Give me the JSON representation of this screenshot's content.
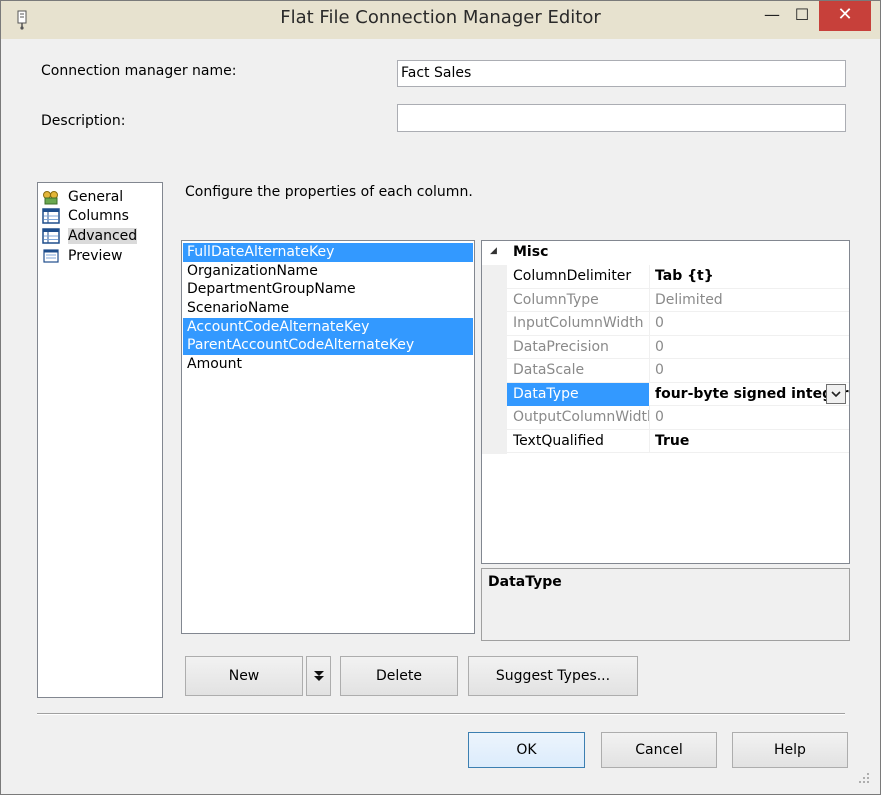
{
  "window": {
    "title": "Flat File Connection Manager Editor",
    "minimize": "—",
    "maximize": "☐",
    "close": "✕"
  },
  "form": {
    "conn_name_label": "Connection manager name:",
    "conn_name_value": "Fact Sales",
    "description_label": "Description:",
    "description_value": ""
  },
  "nav": {
    "items": [
      {
        "label": "General",
        "icon": "general-icon"
      },
      {
        "label": "Columns",
        "icon": "columns-icon"
      },
      {
        "label": "Advanced",
        "icon": "advanced-icon",
        "selected": true
      },
      {
        "label": "Preview",
        "icon": "preview-icon"
      }
    ]
  },
  "instructions": "Configure the properties of each column.",
  "columns": {
    "items": [
      {
        "name": "FullDateAlternateKey",
        "selected": true
      },
      {
        "name": "OrganizationName",
        "selected": false
      },
      {
        "name": "DepartmentGroupName",
        "selected": false
      },
      {
        "name": "ScenarioName",
        "selected": false
      },
      {
        "name": "AccountCodeAlternateKey",
        "selected": true
      },
      {
        "name": "ParentAccountCodeAlternateKey",
        "selected": true
      },
      {
        "name": "Amount",
        "selected": false
      }
    ]
  },
  "properties": {
    "category": "Misc",
    "category_toggle": "◢",
    "rows": [
      {
        "name": "ColumnDelimiter",
        "value": "Tab {t}",
        "style": "bold"
      },
      {
        "name": "ColumnType",
        "value": "Delimited",
        "style": "grey"
      },
      {
        "name": "InputColumnWidth",
        "value": "0",
        "style": "grey"
      },
      {
        "name": "DataPrecision",
        "value": "0",
        "style": "grey"
      },
      {
        "name": "DataScale",
        "value": "0",
        "style": "grey"
      },
      {
        "name": "DataType",
        "value": "four-byte signed integer",
        "style": "selected"
      },
      {
        "name": "OutputColumnWidth",
        "value": "0",
        "style": "grey"
      },
      {
        "name": "TextQualified",
        "value": "True",
        "style": "bold"
      }
    ],
    "description_title": "DataType"
  },
  "buttons": {
    "new": "New",
    "new_dropdown": "▾",
    "delete": "Delete",
    "suggest": "Suggest Types...",
    "ok": "OK",
    "cancel": "Cancel",
    "help": "Help"
  },
  "colors": {
    "selection": "#3399ff",
    "title_bar": "#e7e2cf",
    "close_button": "#c7403a"
  }
}
